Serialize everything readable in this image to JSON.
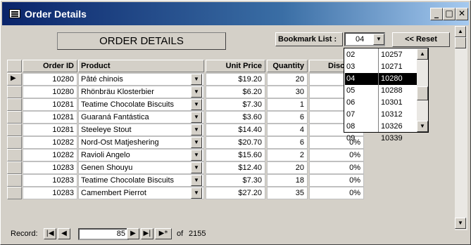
{
  "window": {
    "title": "Order Details"
  },
  "form": {
    "title": "ORDER DETAILS",
    "bookmark_label": "Bookmark List :",
    "bookmark_value": "04",
    "reset_label": "<< Reset"
  },
  "columns": [
    "Order ID",
    "Product",
    "Unit Price",
    "Quantity",
    "Disc"
  ],
  "rows": [
    {
      "order_id": "10280",
      "product": "Pâté chinois",
      "price": "$19.20",
      "qty": "20",
      "disc": ""
    },
    {
      "order_id": "10280",
      "product": "Rhönbräu Klosterbier",
      "price": "$6.20",
      "qty": "30",
      "disc": ""
    },
    {
      "order_id": "10281",
      "product": "Teatime Chocolate Biscuits",
      "price": "$7.30",
      "qty": "1",
      "disc": ""
    },
    {
      "order_id": "10281",
      "product": "Guaraná Fantástica",
      "price": "$3.60",
      "qty": "6",
      "disc": ""
    },
    {
      "order_id": "10281",
      "product": "Steeleye Stout",
      "price": "$14.40",
      "qty": "4",
      "disc": ""
    },
    {
      "order_id": "10282",
      "product": "Nord-Ost Matjeshering",
      "price": "$20.70",
      "qty": "6",
      "disc": "0%"
    },
    {
      "order_id": "10282",
      "product": "Ravioli Angelo",
      "price": "$15.60",
      "qty": "2",
      "disc": "0%"
    },
    {
      "order_id": "10283",
      "product": "Genen Shouyu",
      "price": "$12.40",
      "qty": "20",
      "disc": "0%"
    },
    {
      "order_id": "10283",
      "product": "Teatime Chocolate Biscuits",
      "price": "$7.30",
      "qty": "18",
      "disc": "0%"
    },
    {
      "order_id": "10283",
      "product": "Camembert Pierrot",
      "price": "$27.20",
      "qty": "35",
      "disc": "0%"
    }
  ],
  "bookmark_list": [
    {
      "key": "02",
      "order": "10257"
    },
    {
      "key": "03",
      "order": "10271"
    },
    {
      "key": "04",
      "order": "10280",
      "selected": true
    },
    {
      "key": "05",
      "order": "10288"
    },
    {
      "key": "06",
      "order": "10301"
    },
    {
      "key": "07",
      "order": "10312"
    },
    {
      "key": "08",
      "order": "10326"
    },
    {
      "key": "09",
      "order": "10339"
    }
  ],
  "nav": {
    "label": "Record:",
    "current": "85",
    "of_label": "of",
    "total": "2155"
  },
  "icons": {
    "app": "form-icon",
    "min": "minimize-icon",
    "max": "maximize-icon",
    "close": "close-icon"
  }
}
